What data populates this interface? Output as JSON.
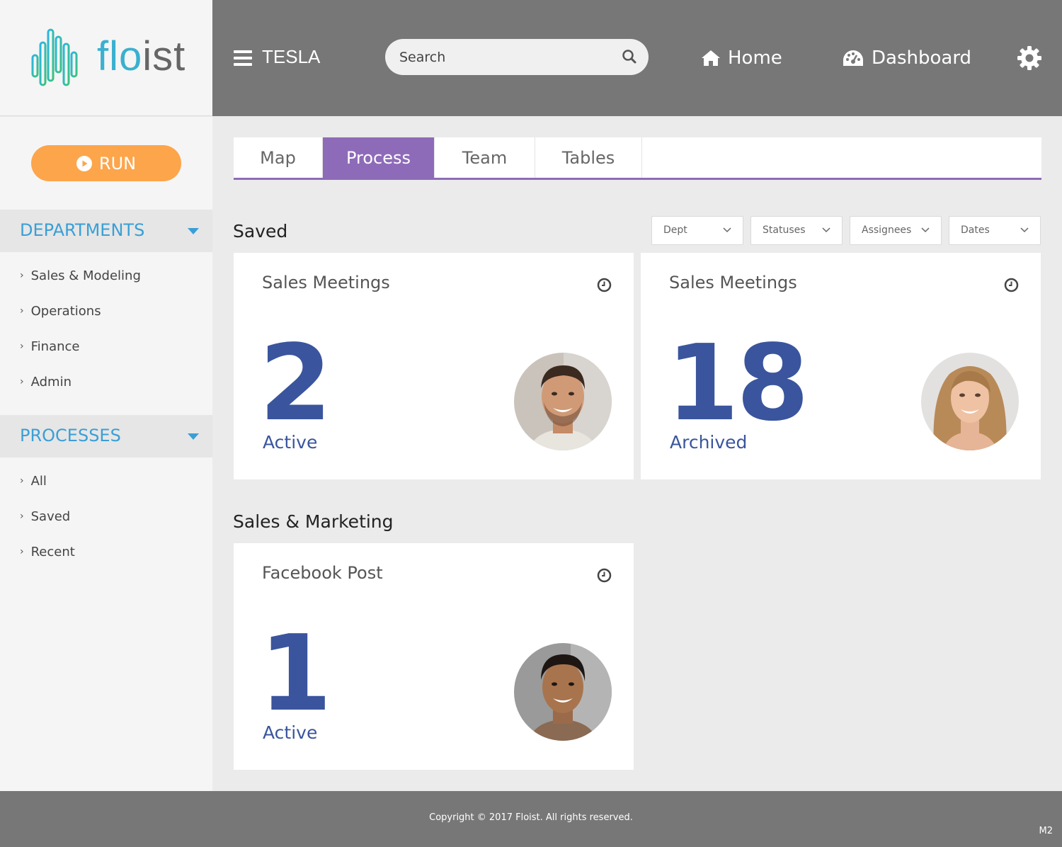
{
  "brand": {
    "name_part1": "flo",
    "name_part2": "ist",
    "logo_icon": "waveform-logo"
  },
  "header": {
    "org_name": "TESLA",
    "search_placeholder": "Search",
    "nav": {
      "home": "Home",
      "dashboard": "Dashboard"
    },
    "icons": [
      "menu-icon",
      "search-icon",
      "home-icon",
      "dashboard-icon",
      "gear-icon"
    ]
  },
  "sidebar": {
    "run_label": "RUN",
    "departments": {
      "title": "DEPARTMENTS",
      "items": [
        "Sales & Modeling",
        "Operations",
        "Finance",
        "Admin"
      ]
    },
    "processes": {
      "title": "PROCESSES",
      "items": [
        "All",
        "Saved",
        "Recent"
      ]
    }
  },
  "tabs": {
    "items": [
      "Map",
      "Process",
      "Team",
      "Tables"
    ],
    "active": "Process"
  },
  "filters": [
    "Dept",
    "Statuses",
    "Assignees",
    "Dates"
  ],
  "sections": {
    "saved": {
      "title": "Saved",
      "cards": [
        {
          "title": "Sales Meetings",
          "count": "2",
          "status": "Active"
        },
        {
          "title": "Sales Meetings",
          "count": "18",
          "status": "Archived"
        }
      ]
    },
    "sales_marketing": {
      "title": "Sales & Marketing",
      "cards": [
        {
          "title": "Facebook Post",
          "count": "1",
          "status": "Active"
        }
      ]
    }
  },
  "footer": {
    "copyright": "Copyright  ©  2017   Floist.    All rights reserved.",
    "version": "M2"
  },
  "colors": {
    "accent_purple": "#8e6bb8",
    "number_blue": "#3a559d",
    "run_orange": "#fda54b",
    "section_blue": "#3a9fd6",
    "bar_gray": "#777777"
  }
}
